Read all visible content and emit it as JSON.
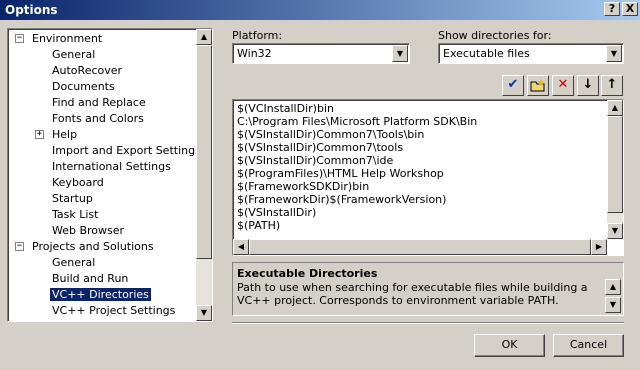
{
  "window": {
    "title": "Options",
    "help_label": "?",
    "close_label": "X"
  },
  "tree": {
    "items": [
      {
        "label": "Environment",
        "expander": "−"
      },
      {
        "label": "General"
      },
      {
        "label": "AutoRecover"
      },
      {
        "label": "Documents"
      },
      {
        "label": "Find and Replace"
      },
      {
        "label": "Fonts and Colors"
      },
      {
        "label": "Help",
        "expander": "+"
      },
      {
        "label": "Import and Export Settings"
      },
      {
        "label": "International Settings"
      },
      {
        "label": "Keyboard"
      },
      {
        "label": "Startup"
      },
      {
        "label": "Task List"
      },
      {
        "label": "Web Browser"
      },
      {
        "label": "Projects and Solutions",
        "expander": "−"
      },
      {
        "label": "General"
      },
      {
        "label": "Build and Run"
      },
      {
        "label": "VC++ Directories",
        "selected": true
      },
      {
        "label": "VC++ Project Settings"
      }
    ]
  },
  "platform": {
    "label": "Platform:",
    "value": "Win32"
  },
  "show_dirs": {
    "label": "Show directories for:",
    "value": "Executable files"
  },
  "toolbar": {
    "new_line_icon": "checkmark-icon",
    "new_folder_icon": "new-folder-icon",
    "delete_icon": "delete-icon",
    "move_down_icon": "arrow-down-icon",
    "move_up_icon": "arrow-up-icon"
  },
  "directories": [
    "$(VCInstallDir)bin",
    "C:\\Program Files\\Microsoft Platform SDK\\Bin",
    "$(VSInstallDir)Common7\\Tools\\bin",
    "$(VSInstallDir)Common7\\tools",
    "$(VSInstallDir)Common7\\ide",
    "$(ProgramFiles)\\HTML Help Workshop",
    "$(FrameworkSDKDir)bin",
    "$(FrameworkDir)$(FrameworkVersion)",
    "$(VSInstallDir)",
    "$(PATH)"
  ],
  "description": {
    "title": "Executable Directories",
    "text": "Path to use when searching for executable files while building a VC++ project.  Corresponds to environment variable PATH."
  },
  "buttons": {
    "ok": "OK",
    "cancel": "Cancel"
  },
  "colors": {
    "selection": "#0a246a",
    "face": "#d4d0c8"
  }
}
